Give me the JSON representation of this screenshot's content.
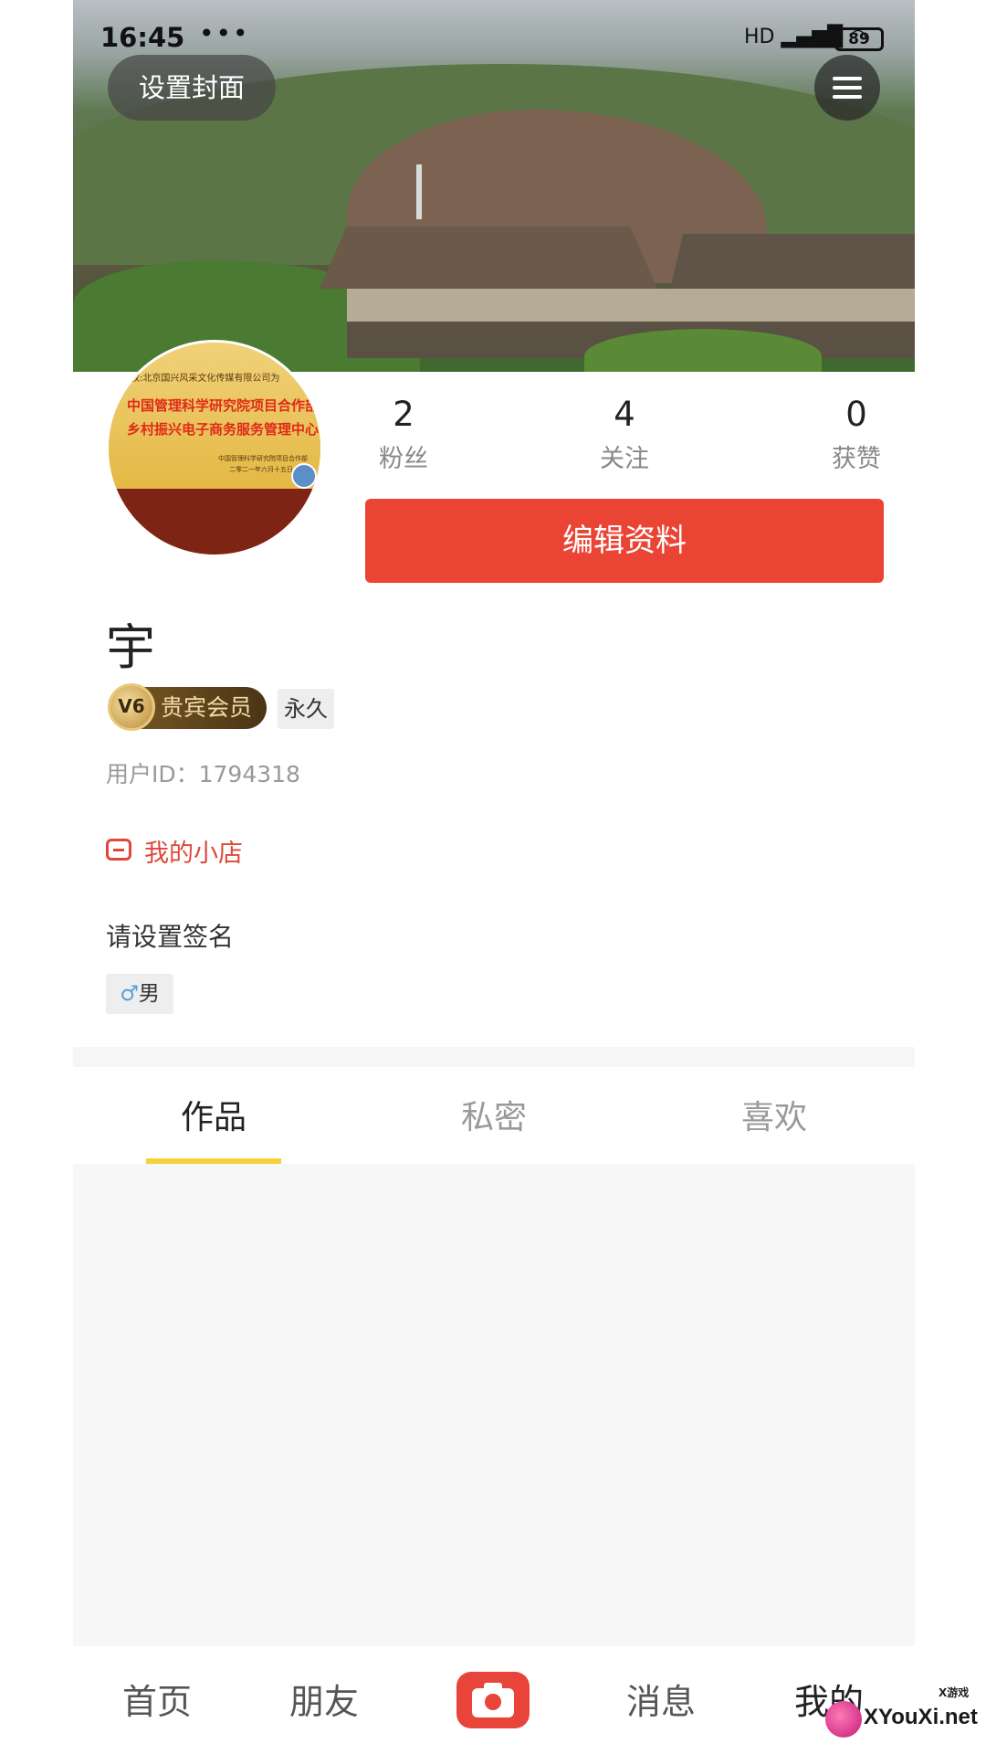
{
  "status_bar": {
    "time": "16:45",
    "dots": "•••",
    "signal": "HD",
    "battery": "89"
  },
  "cover": {
    "set_cover_label": "设置封面"
  },
  "avatar": {
    "line1": "授权:北京国兴风采文化传媒有限公司为",
    "line2": "中国管理科学研究院项目合作部",
    "line3": "乡村振兴电子商务服务管理中心",
    "line4": "中国管理科学研究院项目合作部",
    "line5": "二零二一年六月十五日"
  },
  "stats": [
    {
      "value": "2",
      "label": "粉丝"
    },
    {
      "value": "4",
      "label": "关注"
    },
    {
      "value": "0",
      "label": "获赞"
    }
  ],
  "edit_profile_label": "编辑资料",
  "user": {
    "name": "宇",
    "vip_badge_icon_text": "V6",
    "vip_label": "贵宾会员",
    "vip_duration": "永久",
    "user_id": "用户ID：1794318",
    "shop_label": "我的小店",
    "signature": "请设置签名",
    "gender_symbol": "♂",
    "gender": "男"
  },
  "tabs": [
    {
      "label": "作品",
      "active": true
    },
    {
      "label": "私密",
      "active": false
    },
    {
      "label": "喜欢",
      "active": false
    }
  ],
  "bottom_nav": [
    {
      "label": "首页"
    },
    {
      "label": "朋友"
    },
    {
      "label": "消息"
    },
    {
      "label": "我的",
      "active": true
    }
  ],
  "watermark": {
    "small": "X游戏",
    "main": "XYouXi.net"
  },
  "colors": {
    "accent_red": "#ea4534",
    "tab_indicator": "#f5d23b",
    "shop_red": "#e0473a"
  }
}
